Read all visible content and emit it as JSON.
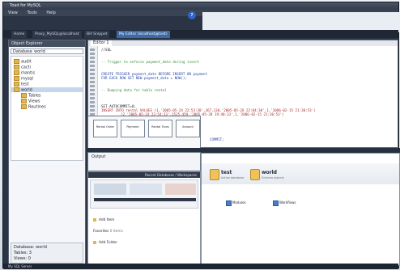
{
  "window": {
    "title": "Toad for MySQL",
    "menu": [
      "View",
      "Tools",
      "Help"
    ]
  },
  "tabs": [
    {
      "label": "Home"
    },
    {
      "label": "Proxy_MySQL@localhost"
    },
    {
      "label": "Bill Snippet"
    },
    {
      "label": "My Editor (localhost@test)"
    }
  ],
  "left_panel": {
    "title": "Object Explorer",
    "search_label": "Database",
    "search_value": "world",
    "tree": [
      "audit",
      "cacti",
      "mantis",
      "mysql",
      "test",
      "world",
      "Tables",
      "Views",
      "Routines"
    ],
    "info_lines": [
      "Database: world",
      "Tables: 3",
      "Views: 0"
    ]
  },
  "editor": {
    "tab_label": "Editor 1",
    "lines": [
      "//SQL",
      "",
      "-- Trigger to enforce payment_date during insert",
      "",
      "CREATE TRIGGER payment_date BEFORE INSERT ON payment",
      "  FOR EACH ROW SET NEW.payment_date = NOW();",
      "",
      "-- Dumping data for table rental",
      "",
      "SET AUTOCOMMIT=0;",
      "INSERT INTO rental VALUES (1,'2005-05-24 22:53:30',367,130,'2005-05-26 22:04:30',1,'2006-02-15 21:30:53')",
      "(2,'2005-05-24 22:54:33',1525,459,'2005-05-28 19:40:33',1,'2006-02-15 21:30:53')",
      "",
      "",
      "COMMIT;"
    ]
  },
  "diagram": {
    "nodes": [
      "Rental Order",
      "Payment",
      "Rental Trans",
      "Amount"
    ]
  },
  "output": {
    "title": "Output"
  },
  "db_panel": {
    "databases": [
      {
        "name": "test",
        "sub": "Active database"
      },
      {
        "name": "world",
        "sub": "Schema objects"
      }
    ],
    "links": [
      "Modules",
      "Workflows"
    ]
  },
  "bottom_list": {
    "header": "Recent Databases / Workspaces",
    "items": [
      "Add Item",
      "Favorites",
      "Add Folder"
    ],
    "favorites_count": "0 items"
  },
  "status": {
    "text": "My SQL Server"
  },
  "colors": {
    "accent": "#3d6aa3",
    "folder": "#e3b64a"
  }
}
